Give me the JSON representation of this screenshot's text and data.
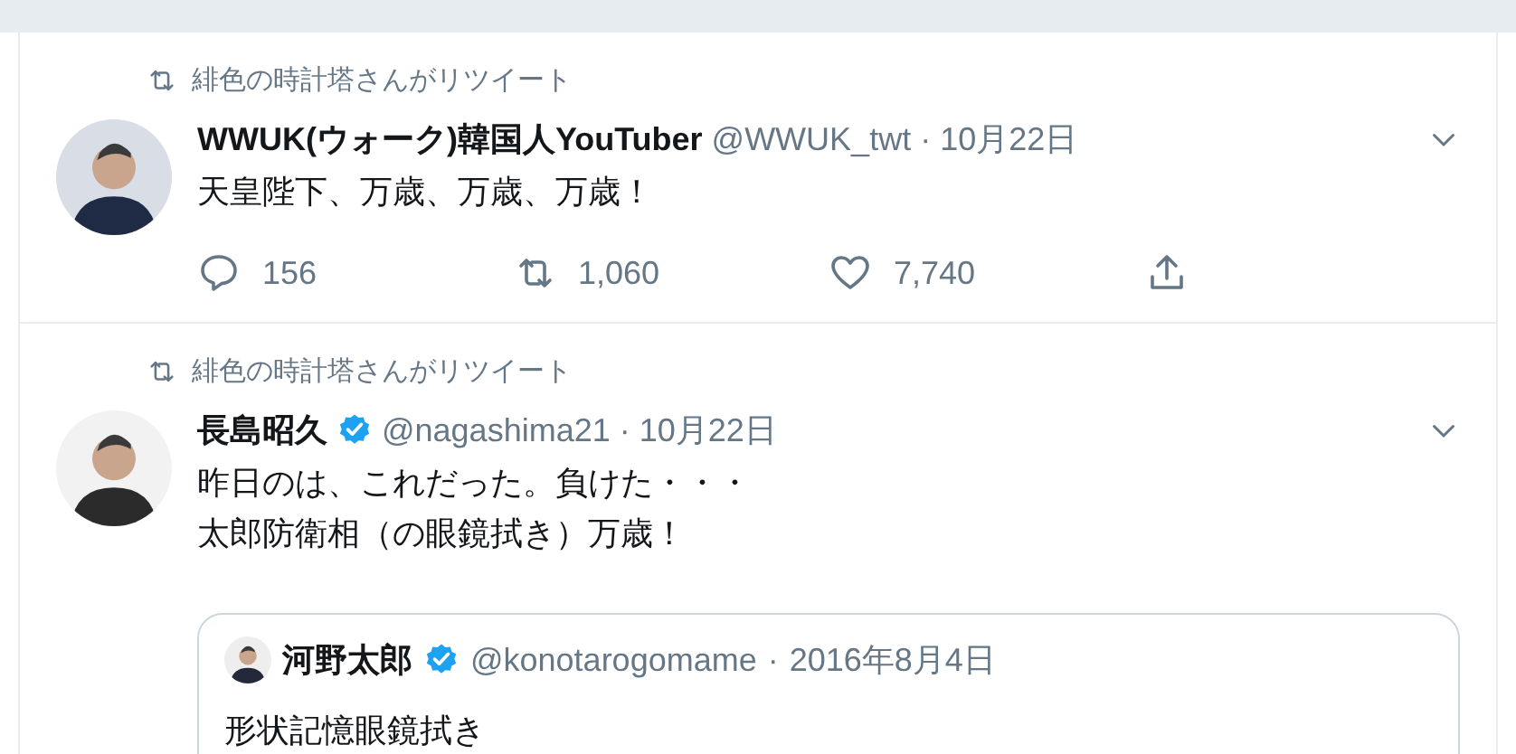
{
  "tweets": [
    {
      "retweeted_by": "緋色の時計塔さんがリツイート",
      "name": "WWUK(ウォーク)韓国人YouTuber",
      "verified": false,
      "handle": "@WWUK_twt",
      "separator": "·",
      "date": "10月22日",
      "lines": [
        "天皇陛下、万歳、万歳、万歳！"
      ],
      "actions": [
        {
          "kind": "reply",
          "count": "156"
        },
        {
          "kind": "retweet",
          "count": "1,060"
        },
        {
          "kind": "like",
          "count": "7,740"
        },
        {
          "kind": "share"
        }
      ]
    },
    {
      "retweeted_by": "緋色の時計塔さんがリツイート",
      "name": "長島昭久",
      "verified": true,
      "handle": "@nagashima21",
      "separator": "·",
      "date": "10月22日",
      "lines": [
        "昨日のは、これだった。負けた・・・",
        "太郎防衛相（の眼鏡拭き）万歳！"
      ],
      "quote": {
        "name": "河野太郎",
        "verified": true,
        "handle": "@konotarogomame",
        "separator": "·",
        "date": "2016年8月4日",
        "text": "形状記憶眼鏡拭き"
      }
    }
  ]
}
